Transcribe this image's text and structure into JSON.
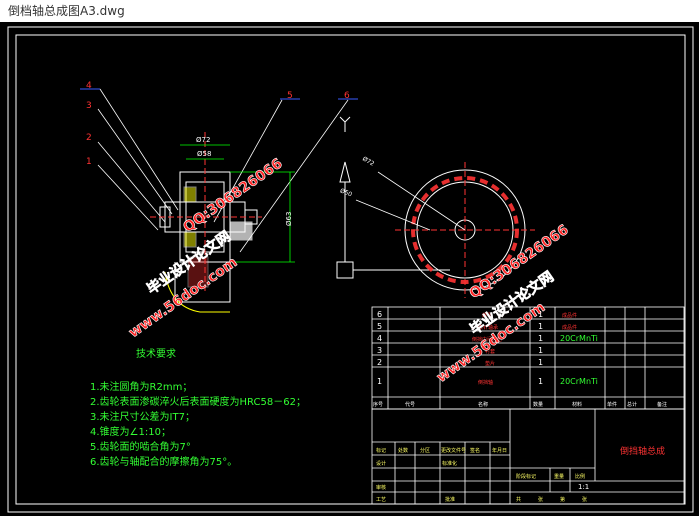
{
  "window": {
    "title": "倒档轴总成图A3.dwg"
  },
  "colors": {
    "background": "#000000",
    "outline": "#ffffff",
    "callout": "#ff0000",
    "leader_blue": "#3a5cff",
    "text_green": "#33ff33",
    "watermark": "#ff2222",
    "table_line": "#ffffff",
    "dimension": "#00ff00"
  },
  "callouts": [
    "1",
    "2",
    "3",
    "4",
    "5",
    "6"
  ],
  "dimensions": {
    "d1": "Ø72",
    "d2": "Ø58",
    "d3": "Ø63",
    "d4": "Ø72",
    "d5": "Ø50"
  },
  "tech": {
    "heading": "技术要求",
    "items": [
      "1.未注圆角为R2mm；",
      "2.齿轮表面渗碳淬火后表面硬度为HRC58－62；",
      "3.未注尺寸公差为IT7；",
      "4.锥度为∠1:10；",
      "5.齿轮面的啮合角为7°",
      "6.齿轮与轴配合的摩擦角为75°。"
    ]
  },
  "bom": {
    "rows": [
      {
        "no": "6",
        "name": "螺母",
        "qty": "1",
        "mat": "成品件"
      },
      {
        "no": "5",
        "name": "滚针轴承",
        "qty": "1",
        "mat": "成品件"
      },
      {
        "no": "4",
        "name": "倒挡中间齿轮",
        "qty": "1",
        "mat": "20CrMnTi"
      },
      {
        "no": "3",
        "name": "衬套",
        "qty": "1",
        "mat": ""
      },
      {
        "no": "2",
        "name": "垫片",
        "qty": "1",
        "mat": ""
      },
      {
        "no": "1",
        "name": "倒挡轴",
        "qty": "1",
        "mat": "20CrMnTi"
      }
    ],
    "headers": [
      "序号",
      "代号",
      "名称",
      "数量",
      "材料",
      "单件",
      "总计",
      "备注"
    ]
  },
  "titleblock": {
    "drawing_name": "倒挡轴总成",
    "labels": {
      "mark": "标记",
      "count": "处数",
      "zone": "分区",
      "change": "更改文件号",
      "sign": "签名",
      "date": "年月日",
      "design": "设计",
      "standard": "标准化",
      "review": "审核",
      "craft": "工艺",
      "approve": "批准",
      "stage": "阶段标记",
      "weight": "重量",
      "scale": "比例",
      "scale_value": "1:1",
      "total": "共",
      "sheet": "张",
      "page": "第",
      "sheet2": "张"
    }
  },
  "watermarks": [
    "毕业设计论文网",
    "www.56doc.com",
    "QQ:306826066"
  ]
}
